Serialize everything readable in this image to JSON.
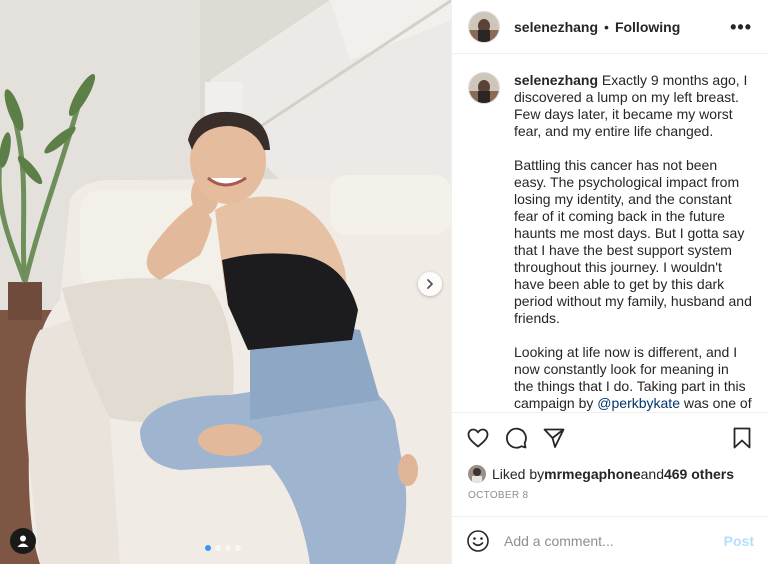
{
  "post": {
    "username": "selenezhang",
    "follow_separator": "•",
    "follow_label": "Following",
    "more_label": "•••"
  },
  "caption": {
    "username": "selenezhang",
    "paragraphs": [
      "Exactly 9 months ago, I discovered a lump on my left breast. Few days later, it became my worst fear, and my entire life changed.",
      "Battling this cancer has not been easy. The psychological impact from losing my identity, and the constant fear of it coming back in the future haunts me most days. But I gotta say that I have the best support system throughout this journey. I wouldn't have been able to get by this dark period without my family, husband and friends."
    ],
    "p3_before": "Looking at life now is different, and I now constantly look for meaning in the things that I do. Taking part in this campaign by ",
    "p3_mention": "@perkbykate",
    "p3_after": " was one of"
  },
  "likes": {
    "prefix": "Liked by ",
    "user": "mrmegaphone",
    "middle": " and ",
    "count": "469 others"
  },
  "date": "OCTOBER 8",
  "comment": {
    "placeholder": "Add a comment...",
    "post_label": "Post"
  },
  "carousel": {
    "total": 4,
    "active_index": 0
  },
  "colors": {
    "accent": "#3897f0",
    "mention": "#00376b",
    "post_disabled": "#b2dffc",
    "muted": "#8e8e8e"
  },
  "icons": [
    "heart-icon",
    "comment-icon",
    "share-icon",
    "bookmark-icon",
    "emoji-icon",
    "chevron-right-icon",
    "user-tag-icon"
  ]
}
